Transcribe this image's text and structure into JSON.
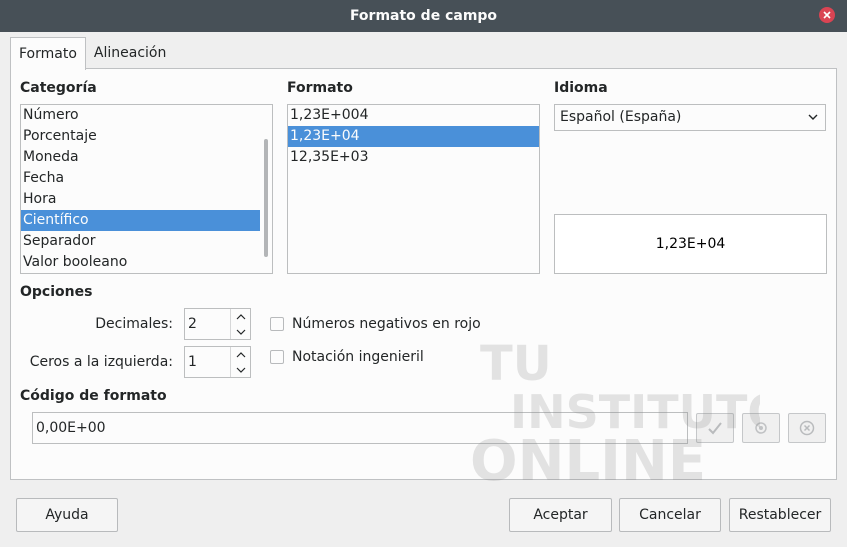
{
  "dialog": {
    "title": "Formato de campo"
  },
  "tabs": [
    {
      "label": "Formato",
      "active": true
    },
    {
      "label": "Alineación",
      "active": false
    }
  ],
  "categoria": {
    "label": "Categoría",
    "items": [
      "Número",
      "Porcentaje",
      "Moneda",
      "Fecha",
      "Hora",
      "Científico",
      "Separador",
      "Valor booleano"
    ],
    "selected": "Científico"
  },
  "formato": {
    "label": "Formato",
    "items": [
      "1,23E+004",
      "1,23E+04",
      "12,35E+03"
    ],
    "selected": "1,23E+04"
  },
  "idioma": {
    "label": "Idioma",
    "value": "Español (España)"
  },
  "preview": {
    "value": "1,23E+04"
  },
  "opciones": {
    "label": "Opciones",
    "decimales_label": "Decimales:",
    "decimales_value": "2",
    "ceros_label": "Ceros a la izquierda:",
    "ceros_value": "1",
    "negativos_label": "Números negativos en rojo",
    "ingenieril_label": "Notación ingenieril"
  },
  "codigo": {
    "label": "Código de formato",
    "value": "0,00E+00"
  },
  "buttons": {
    "ayuda": "Ayuda",
    "aceptar": "Aceptar",
    "cancelar": "Cancelar",
    "restablecer": "Restablecer"
  },
  "watermark": {
    "line1": "TU",
    "line2": "INSTITUTO",
    "line3": "ONLINE"
  },
  "colors": {
    "titlebar": "#475057",
    "selection": "#4a90d9",
    "close": "#da4453"
  }
}
